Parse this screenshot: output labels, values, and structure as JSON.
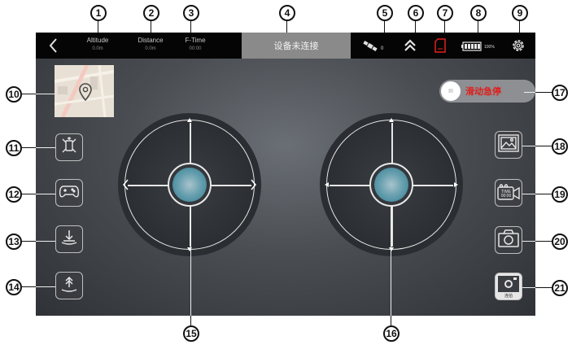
{
  "callouts": [
    "1",
    "2",
    "3",
    "4",
    "5",
    "6",
    "7",
    "8",
    "9",
    "10",
    "11",
    "12",
    "13",
    "14",
    "15",
    "16",
    "17",
    "18",
    "19",
    "20",
    "21"
  ],
  "topbar": {
    "altitude_label": "Altitude",
    "altitude_value": "0.0m",
    "distance_label": "Distance",
    "distance_value": "0.0m",
    "ftime_label": "F-Time",
    "ftime_value": "00:00",
    "connection_status": "设备未连接",
    "satellite_count": "0",
    "battery_percent": "100%"
  },
  "switch": {
    "label": "滑动急停",
    "knob_text": "III"
  },
  "buttons": {
    "record_text": "TIME 00:00",
    "photo_label": "连拍"
  },
  "colors": {
    "accent_red": "#e0201c",
    "joystick_blue": "#4e93a6"
  },
  "icons": [
    "back-chevron-icon",
    "satellite-icon",
    "return-home-icon",
    "sd-card-icon",
    "battery-icon",
    "settings-gear-icon",
    "map-pin-icon",
    "flip-icon",
    "gamepad-icon",
    "land-icon",
    "takeoff-icon",
    "gallery-icon",
    "video-camera-icon",
    "camera-icon",
    "photo-burst-icon"
  ]
}
